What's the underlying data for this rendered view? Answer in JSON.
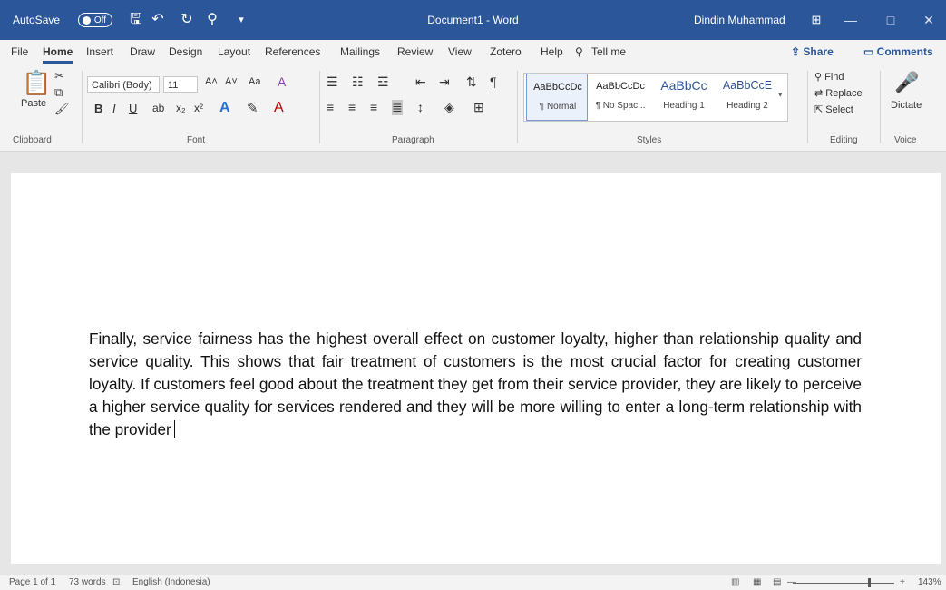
{
  "titlebar": {
    "autosave_label": "AutoSave",
    "autosave_state": "Off",
    "title": "Document1 - Word",
    "user": "Dindin Muhammad",
    "minimize": "—",
    "maximize": "□",
    "close": "✕",
    "accent": "#2b579a"
  },
  "tabs": [
    {
      "label": "File"
    },
    {
      "label": "Home"
    },
    {
      "label": "Insert"
    },
    {
      "label": "Draw"
    },
    {
      "label": "Design"
    },
    {
      "label": "Layout"
    },
    {
      "label": "References"
    },
    {
      "label": "Mailings"
    },
    {
      "label": "Review"
    },
    {
      "label": "View"
    },
    {
      "label": "Zotero"
    },
    {
      "label": "Help"
    },
    {
      "label": "Tell me"
    }
  ],
  "share_label": "Share",
  "comments_label": "Comments",
  "ribbon": {
    "clipboard": {
      "paste": "Paste",
      "group": "Clipboard"
    },
    "font": {
      "name": "Calibri (Body)",
      "size": "11",
      "case_btn": "Aa",
      "group": "Font"
    },
    "paragraph": {
      "group": "Paragraph"
    },
    "styles": {
      "items": [
        {
          "sample": "AaBbCcDc",
          "name": "¶ Normal"
        },
        {
          "sample": "AaBbCcDc",
          "name": "¶ No Spac..."
        },
        {
          "sample": "AaBbCc",
          "name": "Heading 1"
        },
        {
          "sample": "AaBbCcE",
          "name": "Heading 2"
        }
      ],
      "group": "Styles"
    },
    "editing": {
      "find": "Find",
      "replace": "Replace",
      "select": "Select",
      "group": "Editing"
    },
    "voice": {
      "dictate": "Dictate",
      "group": "Voice"
    }
  },
  "document": {
    "text": "Finally, service fairness has the highest overall effect on customer loyalty, higher than relationship quality and service quality. This shows that fair treatment of customers is the most crucial factor for creating customer loyalty. If customers feel good about the treatment they get from their service provider, they are likely to perceive a higher service quality for services rendered and they will be more willing to enter a long-term relationship with the provider"
  },
  "statusbar": {
    "page": "Page 1 of 1",
    "words": "73 words",
    "language": "English (Indonesia)",
    "zoom": "143%",
    "zoom_minus": "—",
    "zoom_plus": "+"
  }
}
